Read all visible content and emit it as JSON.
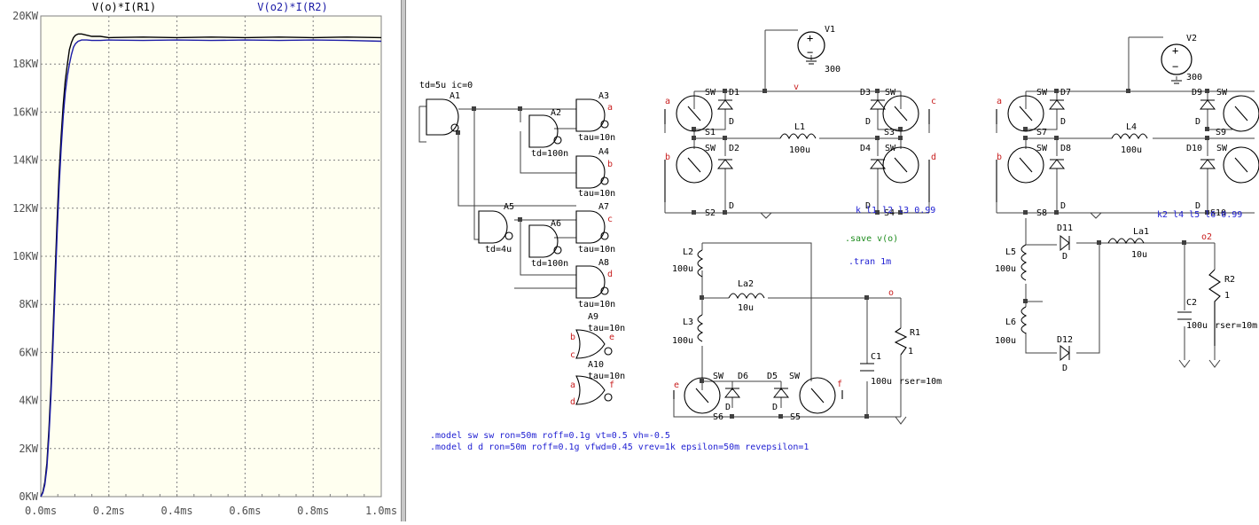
{
  "plot": {
    "trace_labels": [
      "V(o)*I(R1)",
      "V(o2)*I(R2)"
    ],
    "trace_colors": [
      "#000000",
      "#1a1aa6"
    ]
  },
  "chart_data": {
    "type": "line",
    "title": "",
    "xlabel": "",
    "ylabel": "",
    "xlim": [
      0,
      1.0
    ],
    "ylim": [
      0,
      20
    ],
    "x_unit": "ms",
    "y_unit": "KW",
    "x_ticks": [
      "0.0ms",
      "0.2ms",
      "0.4ms",
      "0.6ms",
      "0.8ms",
      "1.0ms"
    ],
    "y_ticks": [
      "0KW",
      "2KW",
      "4KW",
      "6KW",
      "8KW",
      "10KW",
      "12KW",
      "14KW",
      "16KW",
      "18KW",
      "20KW"
    ],
    "grid": true,
    "series": [
      {
        "name": "V(o)*I(R1)",
        "color": "#000000",
        "x": [
          0.0,
          0.006,
          0.012,
          0.018,
          0.024,
          0.03,
          0.036,
          0.042,
          0.048,
          0.054,
          0.06,
          0.066,
          0.072,
          0.078,
          0.084,
          0.09,
          0.096,
          0.102,
          0.11,
          0.12,
          0.135,
          0.15,
          0.175,
          0.2,
          0.3,
          0.4,
          0.5,
          0.6,
          0.7,
          0.8,
          0.9,
          1.0
        ],
        "y": [
          0.0,
          0.2,
          0.6,
          1.4,
          2.8,
          4.6,
          6.8,
          9.2,
          11.5,
          13.5,
          15.0,
          16.3,
          17.3,
          18.0,
          18.6,
          18.9,
          19.1,
          19.2,
          19.25,
          19.25,
          19.2,
          19.15,
          19.15,
          19.1,
          19.12,
          19.1,
          19.12,
          19.1,
          19.12,
          19.1,
          19.12,
          19.1
        ]
      },
      {
        "name": "V(o2)*I(R2)",
        "color": "#1a1aa6",
        "x": [
          0.0,
          0.006,
          0.012,
          0.018,
          0.024,
          0.03,
          0.036,
          0.042,
          0.048,
          0.054,
          0.06,
          0.066,
          0.072,
          0.078,
          0.084,
          0.09,
          0.096,
          0.102,
          0.11,
          0.12,
          0.135,
          0.15,
          0.175,
          0.2,
          0.3,
          0.4,
          0.5,
          0.6,
          0.7,
          0.8,
          0.9,
          1.0
        ],
        "y": [
          0.0,
          0.15,
          0.5,
          1.2,
          2.5,
          4.2,
          6.3,
          8.6,
          10.9,
          12.9,
          14.5,
          15.8,
          16.8,
          17.5,
          18.0,
          18.4,
          18.7,
          18.85,
          18.95,
          19.0,
          19.0,
          18.98,
          18.98,
          19.0,
          18.98,
          19.0,
          18.98,
          19.0,
          18.98,
          19.0,
          18.98,
          18.95
        ]
      }
    ]
  },
  "schematic": {
    "component_labels": {
      "V1": "V1",
      "V1_val": "300",
      "V2": "V2",
      "V2_val": "300",
      "A1": "A1",
      "A2": "A2",
      "A3": "A3",
      "A4": "A4",
      "A5": "A5",
      "A6": "A6",
      "A7": "A7",
      "A8": "A8",
      "A9": "A9",
      "A10": "A10",
      "S1": "S1",
      "S2": "S2",
      "S3": "S3",
      "S4": "S4",
      "S5": "S5",
      "S6": "S6",
      "S7": "S7",
      "S8": "S8",
      "S9": "S9",
      "S10": "S10",
      "D1": "D1",
      "D2": "D2",
      "D3": "D3",
      "D4": "D4",
      "D5": "D5",
      "D6": "D6",
      "D7": "D7",
      "D8": "D8",
      "D9": "D9",
      "D10": "D10",
      "D11": "D11",
      "D12": "D12",
      "L1": "L1",
      "L2": "L2",
      "L3": "L3",
      "L4": "L4",
      "L5": "L5",
      "L6": "L6",
      "La1": "La1",
      "La2": "La2",
      "C1": "C1",
      "C2": "C2",
      "R1": "R1",
      "R2": "R2",
      "SW": "SW",
      "D": "D",
      "100u": "100u",
      "10u": "10u",
      "one": "1",
      "rser": "rser=10m"
    },
    "params": {
      "a1_param": "td=5u ic=0",
      "a2_param": "td=100n",
      "a5_param": "td=4u",
      "a6_param": "td=100n",
      "tau": "tau=10n"
    },
    "nets": {
      "v": "v",
      "o": "o",
      "o2": "o2",
      "a": "a",
      "b": "b",
      "c": "c",
      "d": "d",
      "e": "e",
      "f": "f"
    },
    "directives": {
      "coupling1": "k l1 l2 l3 0.99",
      "coupling2": "k2 l4 l5 l6 0.99",
      "save": ".save v(o)",
      "tran": ".tran 1m",
      "model_sw": ".model sw sw ron=50m roff=0.1g vt=0.5 vh=-0.5",
      "model_d": ".model d d ron=50m roff=0.1g vfwd=0.45 vrev=1k epsilon=50m revepsilon=1"
    },
    "colors": {
      "wire": "#404040",
      "gate_outline": "#000000",
      "pin": "#ff00ff",
      "net_label": "#c81e1e",
      "directive": "#1e1ed2",
      "save_directive": "#1e8c1e",
      "dot": "#404040"
    }
  }
}
